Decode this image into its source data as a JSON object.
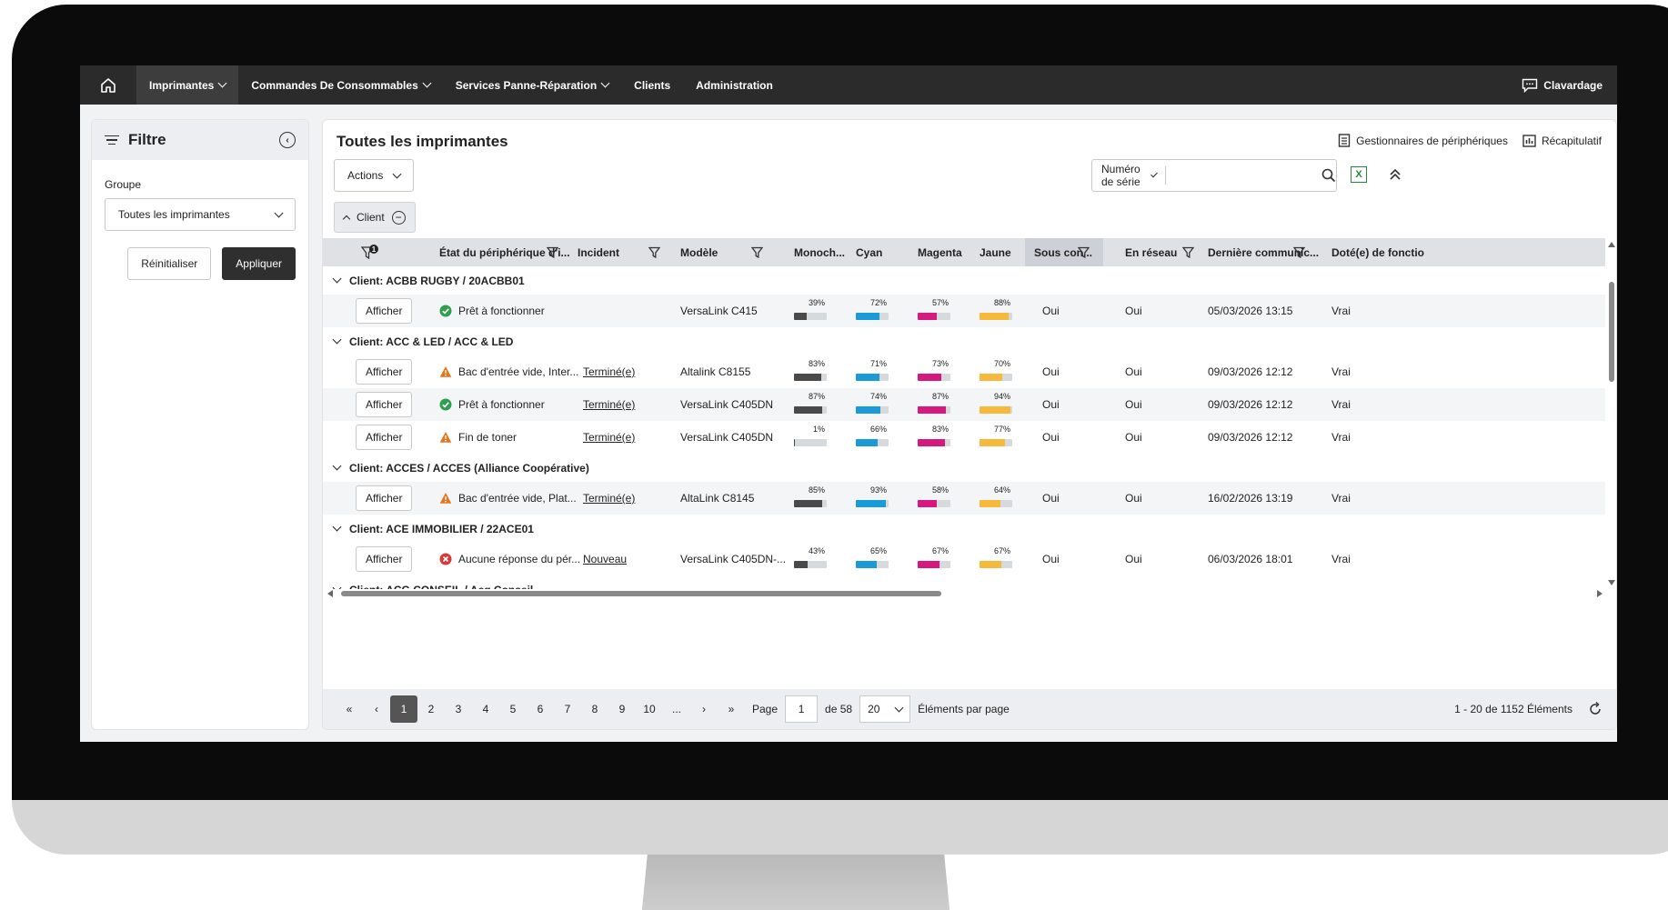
{
  "nav": {
    "items": [
      {
        "label": "Imprimantes",
        "dropdown": true,
        "active": true
      },
      {
        "label": "Commandes De Consommables",
        "dropdown": true
      },
      {
        "label": "Services Panne-Réparation",
        "dropdown": true
      },
      {
        "label": "Clients",
        "dropdown": false
      },
      {
        "label": "Administration",
        "dropdown": false
      }
    ],
    "chat_label": "Clavardage"
  },
  "filter": {
    "title": "Filtre",
    "group_label": "Groupe",
    "group_value": "Toutes les imprimantes",
    "reset_label": "Réinitialiser",
    "apply_label": "Appliquer"
  },
  "main": {
    "title": "Toutes les imprimantes",
    "device_managers_label": "Gestionnaires de périphériques",
    "summary_label": "Récapitulatif",
    "actions_label": "Actions",
    "client_chip_label": "Client",
    "search_field_label": "Numéro de série",
    "search_value": "",
    "excel_label": "X",
    "filter_count": "1"
  },
  "columns": [
    "État du périphérique d'i...",
    "Incident",
    "Modèle",
    "Monoch...",
    "Cyan",
    "Magenta",
    "Jaune",
    "Sous con...",
    "En réseau",
    "Dernière communic...",
    "Doté(e) de fonctio"
  ],
  "colors": {
    "mono": "#4a4a4a",
    "cyan": "#1a9ad6",
    "magenta": "#d6197f",
    "yellow": "#f6b93b",
    "ok": "#2e9e4f",
    "warn": "#e6761b",
    "error": "#d63a3a"
  },
  "groups": [
    {
      "label": "Client: ACBB RUGBY / 20ACBB01",
      "rows": [
        {
          "button": "Afficher",
          "status_icon": "ok",
          "status": "Prêt à fonctionner",
          "incident": "",
          "model": "VersaLink C415",
          "mono": 39,
          "cyan": 72,
          "magenta": 57,
          "yellow": 88,
          "sous_contrat": "Oui",
          "reseau": "Oui",
          "last_comm": "05/03/2026 13:15",
          "feature": "Vrai"
        }
      ]
    },
    {
      "label": "Client: ACC & LED / ACC & LED",
      "rows": [
        {
          "button": "Afficher",
          "status_icon": "warn",
          "status": "Bac d'entrée vide, Inter...",
          "incident": "Terminé(e)",
          "model": "Altalink C8155",
          "mono": 83,
          "cyan": 71,
          "magenta": 73,
          "yellow": 70,
          "sous_contrat": "Oui",
          "reseau": "Oui",
          "last_comm": "09/03/2026 12:12",
          "feature": "Vrai"
        },
        {
          "button": "Afficher",
          "status_icon": "ok",
          "status": "Prêt à fonctionner",
          "incident": "Terminé(e)",
          "model": "VersaLink C405DN",
          "mono": 87,
          "cyan": 74,
          "magenta": 87,
          "yellow": 94,
          "sous_contrat": "Oui",
          "reseau": "Oui",
          "last_comm": "09/03/2026 12:12",
          "feature": "Vrai"
        },
        {
          "button": "Afficher",
          "status_icon": "warn",
          "status": "Fin de toner",
          "incident": "Terminé(e)",
          "model": "VersaLink C405DN",
          "mono": 1,
          "cyan": 66,
          "magenta": 83,
          "yellow": 77,
          "sous_contrat": "Oui",
          "reseau": "Oui",
          "last_comm": "09/03/2026 12:12",
          "feature": "Vrai"
        }
      ]
    },
    {
      "label": "Client: ACCES / ACCES (Alliance Coopérative)",
      "rows": [
        {
          "button": "Afficher",
          "status_icon": "warn",
          "status": "Bac d'entrée vide, Plat...",
          "incident": "Terminé(e)",
          "model": "AltaLink C8145",
          "mono": 85,
          "cyan": 93,
          "magenta": 58,
          "yellow": 64,
          "sous_contrat": "Oui",
          "reseau": "Oui",
          "last_comm": "16/02/2026 13:19",
          "feature": "Vrai"
        }
      ]
    },
    {
      "label": "Client: ACE IMMOBILIER / 22ACE01",
      "rows": [
        {
          "button": "Afficher",
          "status_icon": "error",
          "status": "Aucune réponse du pér...",
          "incident": "Nouveau",
          "model": "VersaLink C405DN-...",
          "mono": 43,
          "cyan": 65,
          "magenta": 67,
          "yellow": 67,
          "sous_contrat": "Oui",
          "reseau": "Oui",
          "last_comm": "06/03/2026 18:01",
          "feature": "Vrai"
        }
      ]
    },
    {
      "label": "Client: ACG CONSEIL / Acg Conseil",
      "rows": []
    }
  ],
  "pagination": {
    "pages": [
      "1",
      "2",
      "3",
      "4",
      "5",
      "6",
      "7",
      "8",
      "9",
      "10",
      "..."
    ],
    "current": "1",
    "page_label": "Page",
    "page_input": "1",
    "of_label": "de 58",
    "page_size": "20",
    "per_page_label": "Éléments par page",
    "summary": "1 - 20 de 1152 Éléments"
  }
}
